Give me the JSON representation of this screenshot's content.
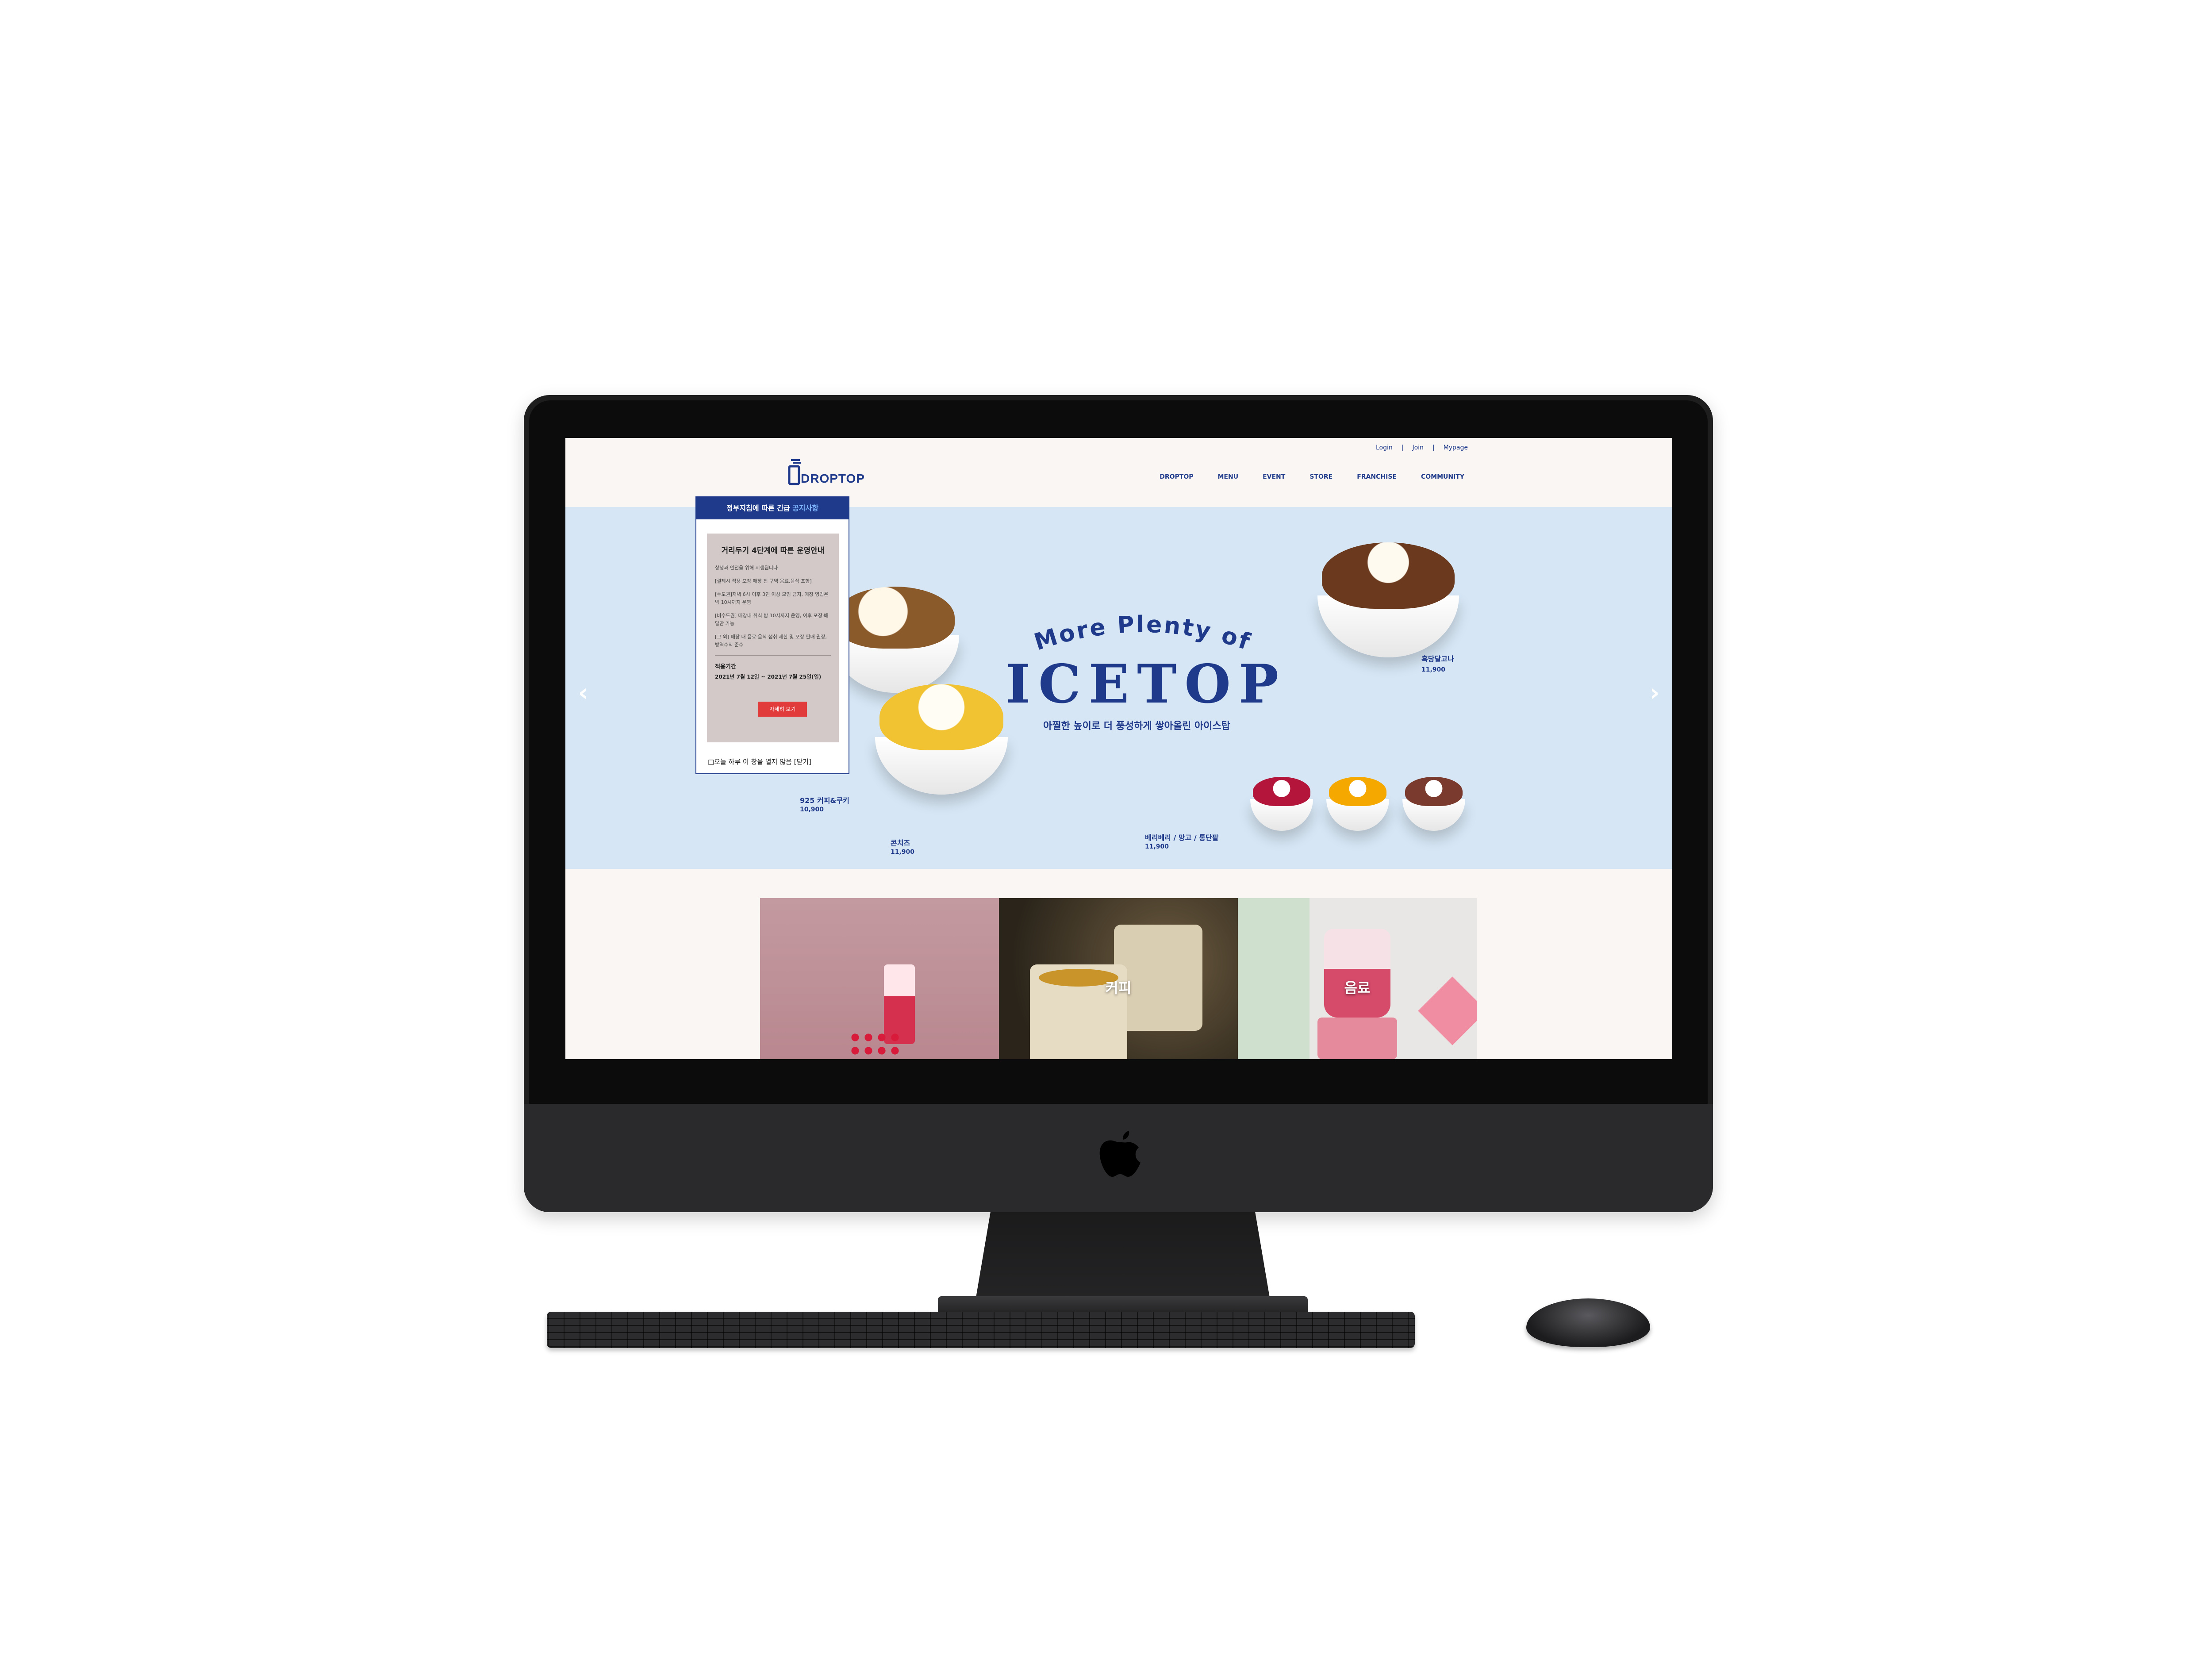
{
  "header": {
    "util_links": [
      "Login",
      "Join",
      "Mypage"
    ],
    "separator": "|",
    "logo_text": "DROPTOP",
    "menu": [
      "DROPTOP",
      "MENU",
      "EVENT",
      "STORE",
      "FRANCHISE",
      "COMMUNITY"
    ]
  },
  "hero": {
    "tagline": "More Plenty of",
    "headline": "ICETOP",
    "subline": "아찔한 높이로 더 풍성하게 쌓아올린 아이스탑",
    "products": [
      {
        "name": "흑당달고나",
        "price": "11,900"
      },
      {
        "name": "925 커피&쿠키",
        "price": "10,900"
      },
      {
        "name": "콘치즈",
        "price": "11,900"
      },
      {
        "name": "베리베리 / 망고 / 통단팥",
        "price": "11,900"
      }
    ],
    "prev_arrow": "‹",
    "next_arrow": "›"
  },
  "popup": {
    "head_prefix": "정부지침에 따른 긴급 ",
    "head_highlight": "공지사항",
    "title": "거리두기 4단계에 따른 운영안내",
    "p1": "상생과 안전을 위해 시행됩니다",
    "p2": "[결제시 적용 포장 매장 전 구역 음료,음식 포함]",
    "p3": "[수도권]저녁 6시 이후 3인 이상 모임 금지, 매장 영업은 밤 10시까지 운영",
    "p4": "[비수도권] 매장내 취식 밤 10시까지 운영, 이후 포장·배달만 가능",
    "p5": "[그 외] 매장 내 음료·음식 섭취 제한 및 포장 판매 권장, 방역수칙 준수",
    "period_label": "적용기간",
    "period": "2021년 7월 12일 ~ 2021년 7월 25일(일)",
    "button": "자세히 보기",
    "footer": "□오늘 하루 이 창을 열지 않음    [닫기]"
  },
  "tiles": [
    {
      "label": ""
    },
    {
      "label": "커피"
    },
    {
      "label": "음료"
    }
  ],
  "colors": {
    "brand_blue": "#1f3a8a",
    "hero_bg": "#d6e6f4",
    "page_bg": "#faf6f4",
    "popup_button": "#e23b3b"
  }
}
